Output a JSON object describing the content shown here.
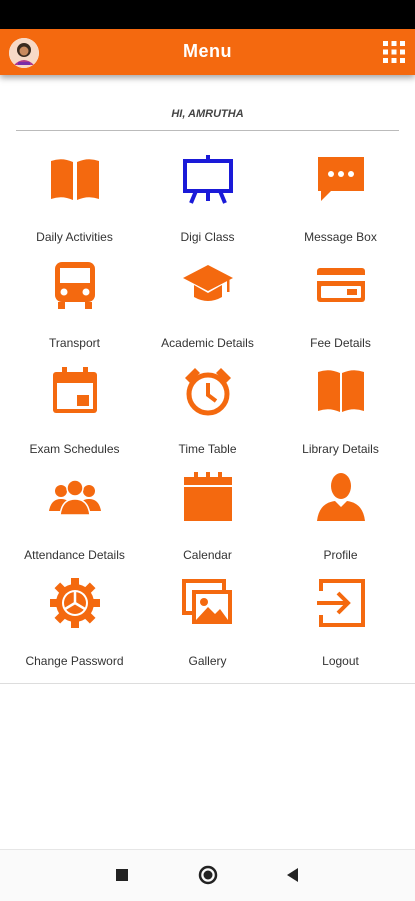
{
  "header": {
    "title": "Menu",
    "menu_icon": "grid-icon"
  },
  "greeting": "HI, AMRUTHA",
  "accent_color": "#f4690f",
  "digi_class_color": "#1a1ad8",
  "menu": [
    {
      "label": "Daily Activities",
      "icon": "book-icon"
    },
    {
      "label": "Digi Class",
      "icon": "easel-icon"
    },
    {
      "label": "Message Box",
      "icon": "chat-icon"
    },
    {
      "label": "Transport",
      "icon": "bus-icon"
    },
    {
      "label": "Academic Details",
      "icon": "graduation-cap-icon"
    },
    {
      "label": "Fee Details",
      "icon": "credit-card-icon"
    },
    {
      "label": "Exam Schedules",
      "icon": "calendar-event-icon"
    },
    {
      "label": "Time Table",
      "icon": "alarm-clock-icon"
    },
    {
      "label": "Library Details",
      "icon": "book-open-icon"
    },
    {
      "label": "Attendance Details",
      "icon": "group-icon"
    },
    {
      "label": "Calendar",
      "icon": "calendar-icon"
    },
    {
      "label": "Profile",
      "icon": "person-icon"
    },
    {
      "label": "Change Password",
      "icon": "gear-icon"
    },
    {
      "label": "Gallery",
      "icon": "gallery-icon"
    },
    {
      "label": "Logout",
      "icon": "logout-icon"
    }
  ],
  "nav": {
    "recents_icon": "square-icon",
    "home_icon": "circle-icon",
    "back_icon": "triangle-back-icon"
  }
}
